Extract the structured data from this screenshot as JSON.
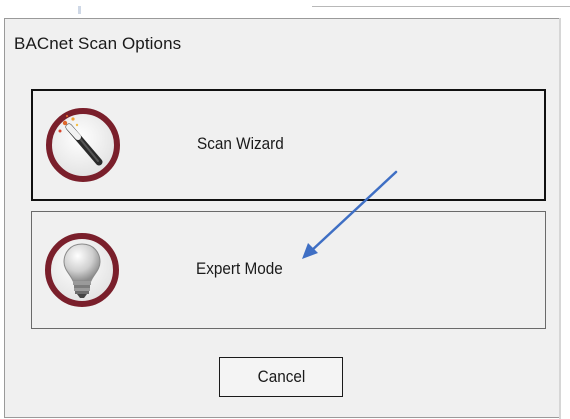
{
  "dialog": {
    "title": "BACnet Scan Options"
  },
  "options": [
    {
      "label": "Scan Wizard",
      "icon": "magic-wand-icon",
      "selected": true
    },
    {
      "label": "Expert Mode",
      "icon": "light-bulb-icon",
      "selected": false
    }
  ],
  "buttons": {
    "cancel_label": "Cancel"
  },
  "colors": {
    "icon_ring": "#7a1f2b",
    "annotation_arrow": "#3f6fc4",
    "dialog_background": "#f0f0f0"
  },
  "annotation": {
    "arrow_target": "Expert Mode"
  }
}
